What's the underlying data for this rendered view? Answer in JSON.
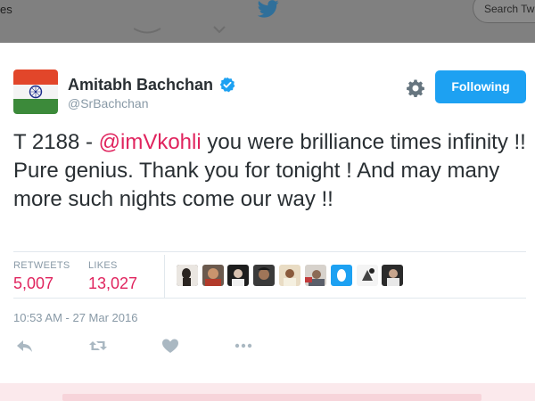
{
  "header": {
    "left_text": "es",
    "search_placeholder": "Search Tw"
  },
  "tweet": {
    "display_name": "Amitabh Bachchan",
    "handle": "@SrBachchan",
    "follow_label": "Following",
    "text_prefix": "T 2188 - ",
    "mention": "@imVkohli",
    "text_body": " you were brilliance times infinity !! Pure genius. Thank you for tonight ! And may many more such nights come our way !!",
    "stats": {
      "retweets_label": "RETWEETS",
      "retweets_value": "5,007",
      "likes_label": "LIKES",
      "likes_value": "13,027"
    },
    "timestamp": "10:53 AM - 27 Mar 2016"
  },
  "icons": [
    "twitter-bird-icon",
    "verified-badge-icon",
    "gear-icon",
    "reply-icon",
    "retweet-icon",
    "like-icon",
    "more-icon"
  ],
  "colors": {
    "brand_blue": "#1da1f2",
    "mention_pink": "#e0245e",
    "muted_gray": "#8899a6",
    "text_dark": "#292f33"
  }
}
